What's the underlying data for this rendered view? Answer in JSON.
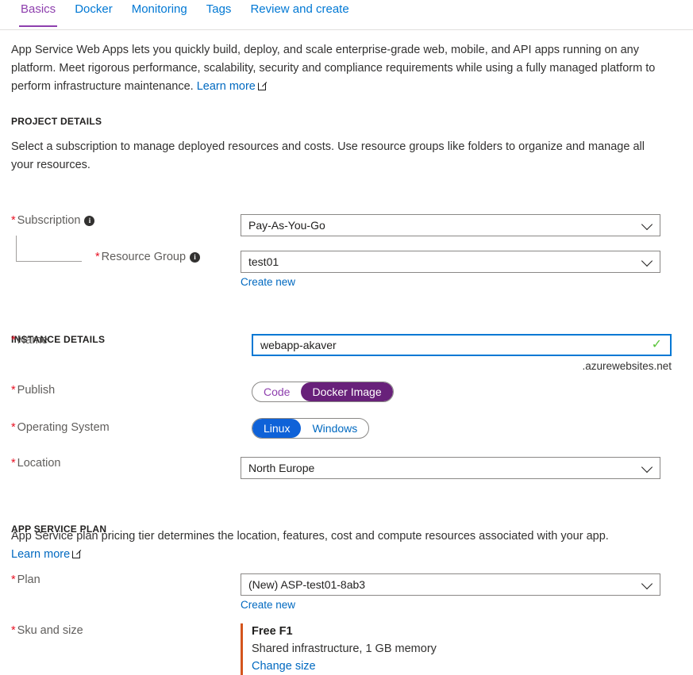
{
  "tabs": [
    {
      "label": "Basics",
      "active": true
    },
    {
      "label": "Docker",
      "active": false
    },
    {
      "label": "Monitoring",
      "active": false
    },
    {
      "label": "Tags",
      "active": false
    },
    {
      "label": "Review and create",
      "active": false
    }
  ],
  "intro": {
    "text": "App Service Web Apps lets you quickly build, deploy, and scale enterprise-grade web, mobile, and API apps running on any platform. Meet rigorous performance, scalability, security and compliance requirements while using a fully managed platform to perform infrastructure maintenance.",
    "learn_more": "Learn more"
  },
  "project_details": {
    "heading": "PROJECT DETAILS",
    "description": "Select a subscription to manage deployed resources and costs. Use resource groups like folders to organize and manage all your resources.",
    "subscription": {
      "label": "Subscription",
      "value": "Pay-As-You-Go"
    },
    "resource_group": {
      "label": "Resource Group",
      "value": "test01",
      "create_new": "Create new"
    }
  },
  "instance_details": {
    "heading": "INSTANCE DETAILS",
    "name": {
      "label": "Name",
      "value": "webapp-akaver",
      "suffix": ".azurewebsites.net",
      "valid": true
    },
    "publish": {
      "label": "Publish",
      "options": [
        "Code",
        "Docker Image"
      ],
      "selected": "Docker Image"
    },
    "operating_system": {
      "label": "Operating System",
      "options": [
        "Linux",
        "Windows"
      ],
      "selected": "Linux"
    },
    "location": {
      "label": "Location",
      "value": "North Europe"
    }
  },
  "app_service_plan": {
    "heading": "APP SERVICE PLAN",
    "description": "App Service plan pricing tier determines the location, features, cost and compute resources associated with your app.",
    "learn_more": "Learn more",
    "plan": {
      "label": "Plan",
      "value": "(New) ASP-test01-8ab3",
      "create_new": "Create new"
    },
    "sku": {
      "label": "Sku and size",
      "title": "Free F1",
      "description": "Shared infrastructure, 1 GB memory",
      "change_link": "Change size"
    }
  },
  "colors": {
    "accent_purple": "#8e3fae",
    "selected_purple": "#68217a",
    "selected_blue": "#0f62d8",
    "link_blue": "#0069c0",
    "required_red": "#e81123",
    "valid_green": "#5ac43a",
    "sku_border_orange": "#d4551d"
  }
}
